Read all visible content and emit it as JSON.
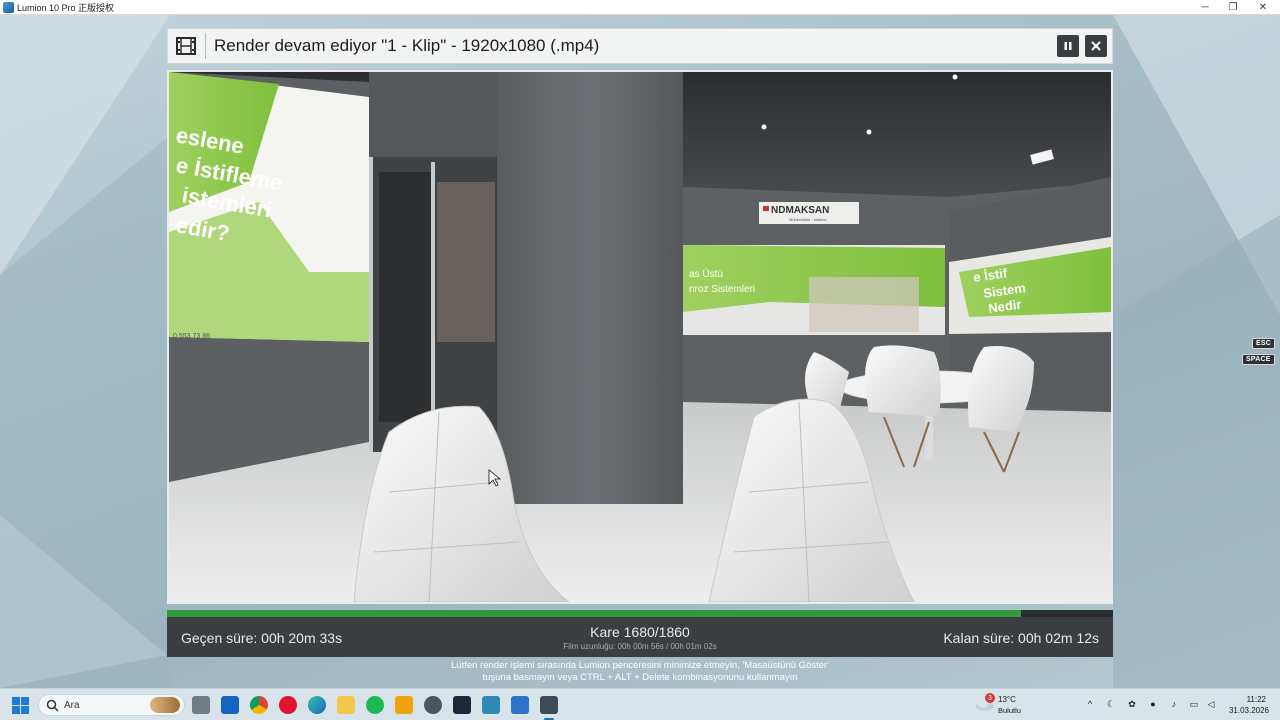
{
  "window": {
    "app_title": "Lumion 10 Pro 正版授权",
    "minimize_symbol": "─",
    "restore_symbol": "❐",
    "close_symbol": "✕"
  },
  "dialog": {
    "title": "Render devam ediyor \"1 - Klip\" - 1920x1080 (.mp4)",
    "film_icon": "film-strip-icon",
    "pause_icon": "pause-icon",
    "close_icon": "close-icon"
  },
  "progress": {
    "percent": 90.3,
    "color": "#2e9a3d"
  },
  "status": {
    "elapsed": "Geçen süre: 00h 20m 33s",
    "frame": "Kare 1680/1860",
    "film_length": "Film uzunluğu: 00h 00m 56s / 00h 01m 02s",
    "remaining": "Kalan süre: 00h 02m 12s"
  },
  "warning": {
    "line1": "Lütfen render işlemi sırasında Lumion penceresini minimize etmeyin, 'Masaüstünü Göster'",
    "line2": "tuşuna basmayın veya CTRL + ALT + Delete kombinasyonunu kullanmayın"
  },
  "key_hints": {
    "esc": "ESC",
    "space": "SPACE"
  },
  "scene": {
    "brand": "NDMAKSAN",
    "brand_tagline": "Mühendislik · Makine",
    "poster_text": [
      "eslene",
      "e İstifleme",
      "istemleri",
      "edir?"
    ],
    "phone": "0 553 73 86",
    "banner_text": [
      "as Üstü",
      "nroz Sistemleri"
    ],
    "right_banner_text": [
      "e İstif",
      "Sistem",
      "Nedir"
    ]
  },
  "taskbar": {
    "search_placeholder": "Ara",
    "weather_badge": "3",
    "weather_temp": "13°C",
    "weather_desc": "Bulutlu",
    "time": "11:22",
    "date": "31.03.2026",
    "apps": [
      "task-view",
      "outlook",
      "chrome",
      "opera",
      "edge",
      "file-explorer",
      "spotify",
      "blender",
      "tracker",
      "steam",
      "monitor",
      "paint",
      "lumion"
    ]
  }
}
